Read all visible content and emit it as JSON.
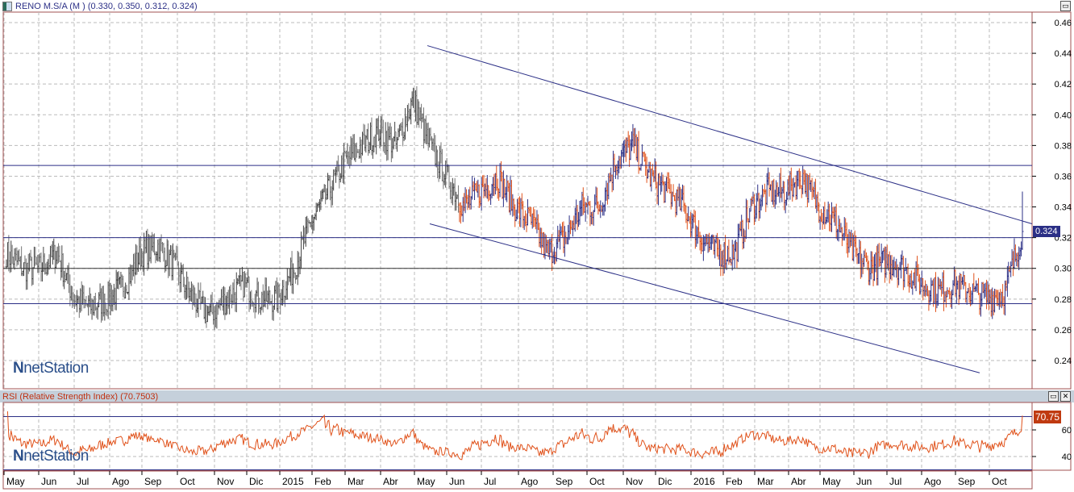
{
  "price_title": "RENO M.S/A (M ) (0.330, 0.350, 0.312, 0.324)",
  "rsi_title": "RSI (Relative Strength Index) (70.7503)",
  "logo": "netStation",
  "buttons": {
    "restore": "▭",
    "close": "✕"
  },
  "chart_data": [
    {
      "type": "ohlc",
      "title": "RENO M.S/A (M )",
      "last": {
        "open": 0.33,
        "high": 0.35,
        "low": 0.312,
        "close": 0.324
      },
      "last_label": "0.324",
      "ylim": [
        0.225,
        0.465
      ],
      "yticks": [
        "0.46",
        "0.44",
        "0.42",
        "0.40",
        "0.38",
        "0.36",
        "0.34",
        "0.32",
        "0.30",
        "0.28",
        "0.26",
        "0.24"
      ],
      "close_keypoints_halfmonthly": [
        0.31,
        0.3,
        0.3,
        0.31,
        0.28,
        0.275,
        0.28,
        0.29,
        0.31,
        0.315,
        0.3,
        0.28,
        0.27,
        0.28,
        0.29,
        0.28,
        0.28,
        0.3,
        0.33,
        0.35,
        0.37,
        0.38,
        0.39,
        0.38,
        0.41,
        0.38,
        0.36,
        0.34,
        0.35,
        0.36,
        0.34,
        0.33,
        0.31,
        0.32,
        0.34,
        0.34,
        0.37,
        0.38,
        0.36,
        0.35,
        0.34,
        0.32,
        0.31,
        0.31,
        0.34,
        0.35,
        0.35,
        0.36,
        0.34,
        0.33,
        0.31,
        0.3,
        0.305,
        0.3,
        0.29,
        0.285,
        0.29,
        0.285,
        0.28,
        0.285,
        0.324
      ],
      "horizontal_lines": [
        0.367,
        0.32,
        0.3,
        0.277
      ],
      "trend_lines": [
        {
          "from": [
            "May 2015",
            0.445
          ],
          "to": [
            "Oct 2016 end",
            0.329
          ]
        },
        {
          "from": [
            "May 2015",
            0.329
          ],
          "to": [
            "Oct 2016",
            0.232
          ]
        }
      ],
      "colors": {
        "early": "#555555",
        "up": "#2b2f86",
        "down": "#e0521b",
        "lines": "#2b2f86"
      }
    },
    {
      "type": "line",
      "title": "RSI (Relative Strength Index)",
      "value": 70.7503,
      "last_label": "70.75",
      "ylim": [
        28,
        76
      ],
      "yticks": [
        "60",
        "40"
      ],
      "levels": [
        70,
        30
      ],
      "color": "#e0521b"
    }
  ],
  "xticks": [
    "May",
    "Jun",
    "Jul",
    "Ago",
    "Sep",
    "Oct",
    "Nov",
    "Dic",
    "2015",
    "Feb",
    "Mar",
    "Abr",
    "May",
    "Jun",
    "Jul",
    "Ago",
    "Sep",
    "Oct",
    "Nov",
    "Dic",
    "2016",
    "Feb",
    "Mar",
    "Abr",
    "May",
    "Jun",
    "Jul",
    "Ago",
    "Sep",
    "Oct"
  ]
}
